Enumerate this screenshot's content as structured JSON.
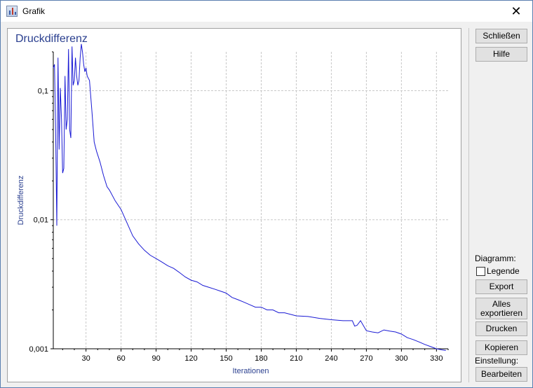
{
  "window": {
    "title": "Grafik",
    "close_glyph": "✕"
  },
  "buttons": {
    "close": "Schließen",
    "help": "Hilfe",
    "export": "Export",
    "export_all_line1": "Alles",
    "export_all_line2": "exportieren",
    "print": "Drucken",
    "copy": "Kopieren",
    "edit": "Bearbeiten"
  },
  "labels": {
    "diagram": "Diagramm:",
    "legend": "Legende",
    "setting": "Einstellung:"
  },
  "legend_checked": false,
  "colors": {
    "series": "#1a1ad4",
    "title": "#2a3f8f",
    "grid": "#c8c8c8"
  },
  "chart_data": {
    "type": "line",
    "title": "Druckdifferenz",
    "xlabel": "Iterationen",
    "ylabel": "Druckdifferenz",
    "y_scale": "log",
    "xlim": [
      2,
      340
    ],
    "ylim": [
      0.001,
      0.2
    ],
    "x_ticks": [
      30,
      60,
      90,
      120,
      150,
      180,
      210,
      240,
      270,
      300,
      330
    ],
    "y_ticks": [
      {
        "value": 0.1,
        "label": "0,1"
      },
      {
        "value": 0.01,
        "label": "0,01"
      },
      {
        "value": 0.001,
        "label": "0,001"
      }
    ],
    "grid": true,
    "series": [
      {
        "x": [
          2,
          3,
          4,
          5,
          6,
          7,
          8,
          9,
          10,
          11,
          12,
          13,
          14,
          15,
          16,
          17,
          18,
          19,
          20,
          21,
          22,
          23,
          24,
          25,
          26,
          27,
          28,
          29,
          30,
          31,
          33,
          35,
          37,
          39,
          42,
          45,
          48,
          50,
          55,
          60,
          65,
          70,
          75,
          80,
          85,
          90,
          95,
          100,
          105,
          110,
          115,
          120,
          125,
          130,
          135,
          140,
          145,
          150,
          155,
          160,
          165,
          170,
          175,
          180,
          185,
          190,
          195,
          200,
          210,
          220,
          230,
          240,
          250,
          255,
          258,
          260,
          262,
          265,
          270,
          275,
          280,
          285,
          290,
          295,
          300,
          305,
          310,
          315,
          320,
          325,
          330,
          335,
          338
        ],
        "y": [
          0.15,
          0.16,
          0.05,
          0.009,
          0.18,
          0.035,
          0.105,
          0.06,
          0.023,
          0.025,
          0.13,
          0.05,
          0.06,
          0.21,
          0.05,
          0.043,
          0.22,
          0.11,
          0.12,
          0.18,
          0.13,
          0.11,
          0.12,
          0.18,
          0.23,
          0.2,
          0.16,
          0.14,
          0.15,
          0.13,
          0.12,
          0.07,
          0.04,
          0.034,
          0.028,
          0.022,
          0.018,
          0.017,
          0.014,
          0.012,
          0.0095,
          0.0075,
          0.0065,
          0.0058,
          0.0053,
          0.005,
          0.0047,
          0.0044,
          0.0042,
          0.0039,
          0.0036,
          0.0034,
          0.0033,
          0.0031,
          0.003,
          0.0029,
          0.0028,
          0.0027,
          0.0025,
          0.0024,
          0.0023,
          0.0022,
          0.0021,
          0.0021,
          0.002,
          0.002,
          0.0019,
          0.0019,
          0.0018,
          0.00178,
          0.00172,
          0.00168,
          0.00165,
          0.00165,
          0.00165,
          0.0015,
          0.00152,
          0.00165,
          0.00138,
          0.00135,
          0.00133,
          0.0014,
          0.00137,
          0.00135,
          0.0013,
          0.00122,
          0.00118,
          0.00113,
          0.00108,
          0.00104,
          0.001,
          0.00098,
          0.00097
        ]
      }
    ]
  }
}
